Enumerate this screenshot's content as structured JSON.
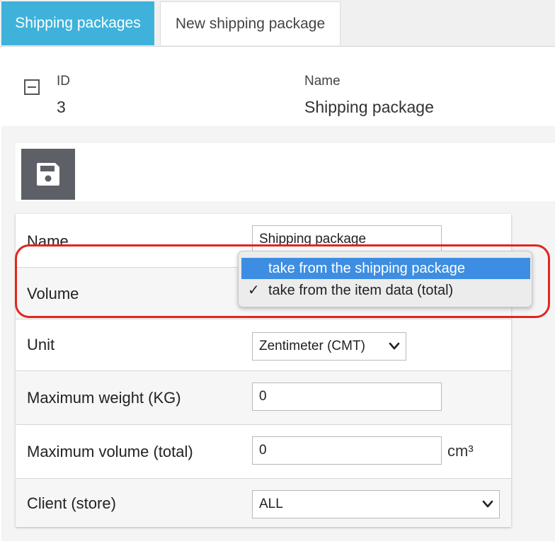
{
  "tabs": [
    {
      "label": "Shipping packages",
      "active": true
    },
    {
      "label": "New shipping package",
      "active": false
    }
  ],
  "record": {
    "id_label": "ID",
    "id_value": "3",
    "name_label": "Name",
    "name_value": "Shipping package"
  },
  "form": {
    "name": {
      "label": "Name",
      "value": "Shipping package"
    },
    "volume": {
      "label": "Volume"
    },
    "unit": {
      "label": "Unit",
      "value": "Zentimeter (CMT)"
    },
    "max_weight": {
      "label": "Maximum weight (KG)",
      "value": "0"
    },
    "max_volume": {
      "label": "Maximum volume (total)",
      "value": "0",
      "suffix": "cm³"
    },
    "client": {
      "label": "Client (store)",
      "value": "ALL"
    }
  },
  "volume_dropdown": {
    "options": [
      {
        "label": "take from the shipping package",
        "highlighted": true,
        "checked": false
      },
      {
        "label": "take from the item data (total)",
        "highlighted": false,
        "checked": true
      }
    ],
    "check_glyph": "✓"
  },
  "colors": {
    "active_tab": "#3eb2db",
    "save_button": "#5e6068",
    "highlight_option": "#3d8ee2",
    "annotation_ring": "#e0261e"
  },
  "icons": {
    "collapse": "collapse-icon",
    "save": "save-floppy-icon",
    "chevron": "chevron-down-icon"
  }
}
